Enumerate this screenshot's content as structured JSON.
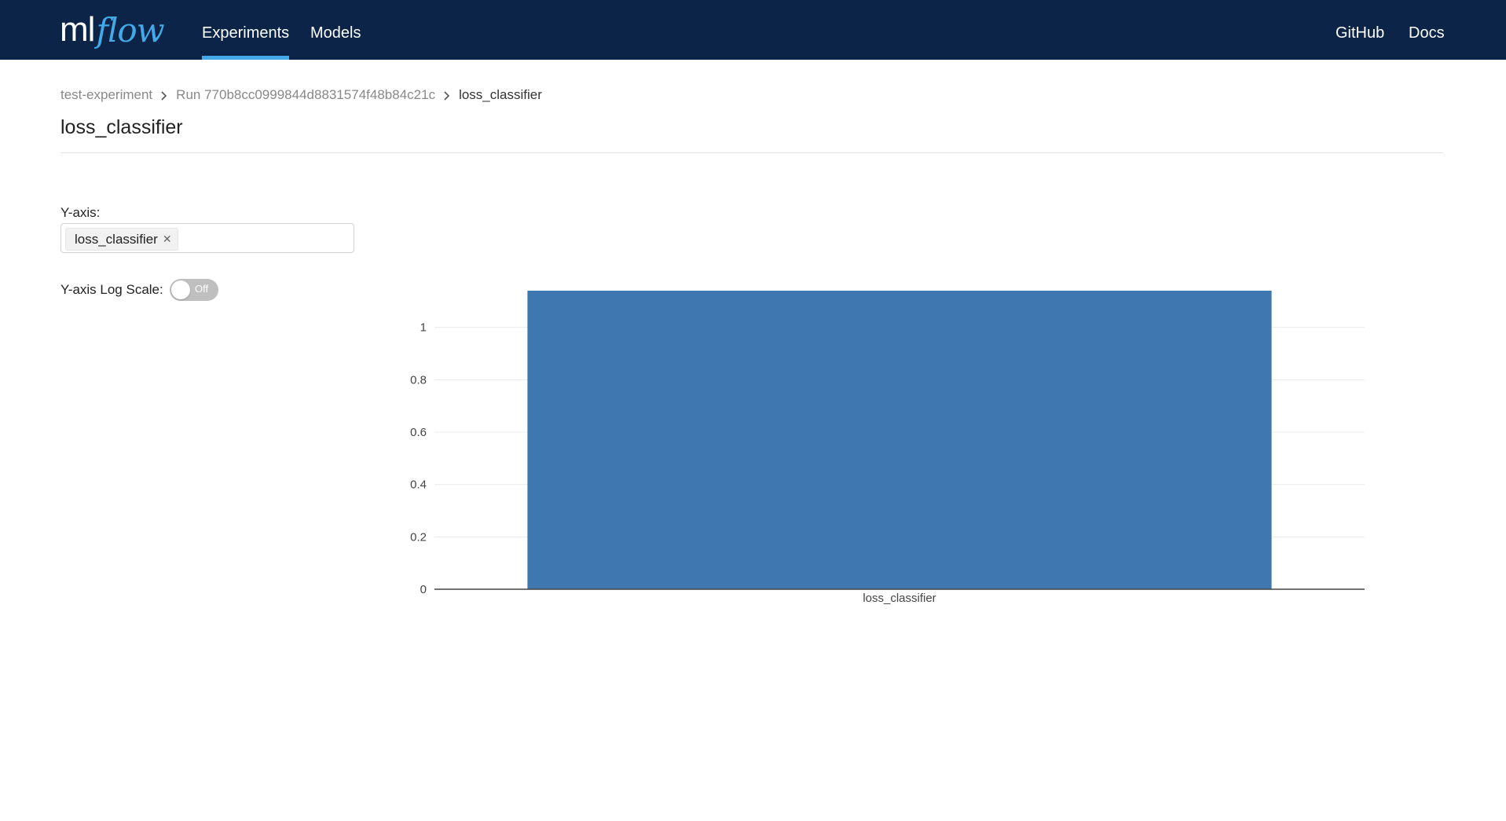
{
  "header": {
    "logo_ml": "ml",
    "logo_flow": "flow",
    "nav": {
      "experiments": "Experiments",
      "models": "Models",
      "github": "GitHub",
      "docs": "Docs"
    },
    "colors": {
      "background": "#0b2448",
      "accent": "#43a9e8"
    }
  },
  "breadcrumb": {
    "experiment": "test-experiment",
    "run": "Run 770b8cc0999844d8831574f48b84c21c",
    "metric": "loss_classifier",
    "separator_icon": "chevron-right-icon"
  },
  "page": {
    "title": "loss_classifier"
  },
  "controls": {
    "yaxis_label": "Y-axis:",
    "yaxis_tag": "loss_classifier",
    "tag_remove_icon": "close-icon",
    "log_scale_label": "Y-axis Log Scale:",
    "log_scale_state": "Off"
  },
  "chart_data": {
    "type": "bar",
    "categories": [
      "loss_classifier"
    ],
    "values": [
      1.14
    ],
    "ylim": [
      0,
      1.14
    ],
    "yticks": [
      0,
      0.2,
      0.4,
      0.6,
      0.8,
      1
    ],
    "ytick_labels": [
      "0",
      "0.2",
      "0.4",
      "0.6",
      "0.8",
      "1"
    ],
    "grid": true,
    "bar_color": "#3f77b0"
  }
}
